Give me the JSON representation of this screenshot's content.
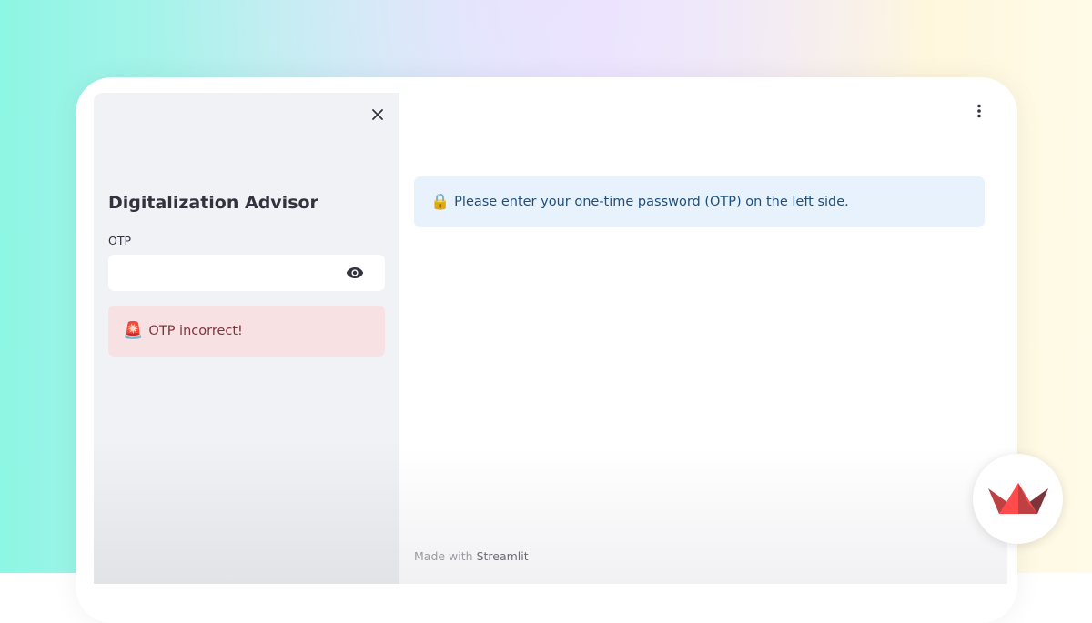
{
  "sidebar": {
    "title": "Digitalization Advisor",
    "otp_label": "OTP",
    "otp_value": "",
    "error": {
      "emoji": "🚨",
      "text": "OTP incorrect!"
    }
  },
  "main": {
    "info": {
      "emoji": "🔒",
      "text": "Please enter your one-time password (OTP) on the left side."
    },
    "footer": {
      "prefix": "Made with",
      "brand": "Streamlit"
    }
  },
  "icons": {
    "close": "close-icon",
    "eye": "eye-icon",
    "menu": "kebab-menu-icon",
    "logo": "streamlit-logo"
  },
  "colors": {
    "sidebar_bg": "#f0f2f6",
    "error_bg": "#f8e1e3",
    "error_text": "#7d353b",
    "info_bg": "#e8f2fc",
    "info_text": "#1e4f7d",
    "brand_red": "#ff4b4b"
  }
}
